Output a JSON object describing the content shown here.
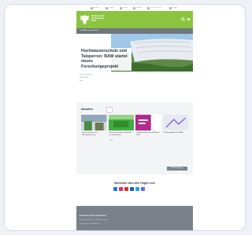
{
  "utility_nav": [
    {
      "label": "Intranet",
      "icon": "lock-icon"
    },
    {
      "label": "Termine",
      "icon": "calendar-icon"
    },
    {
      "label": "Presse",
      "icon": "megaphone-icon"
    },
    {
      "label": "Kontakt",
      "icon": "mail-icon"
    },
    {
      "label": "Leichte Sprache",
      "icon": "language-icon"
    },
    {
      "label": "English",
      "icon": "globe-icon"
    }
  ],
  "header": {
    "logo_line1": "Bundesanstalt",
    "logo_line2": "für Wasserbau",
    "logo_line3": "BAW",
    "brand_color": "#8bc53f"
  },
  "breadcrumb": "Die BAW auf einen Blick",
  "hero": {
    "headline": "Hochwasserschutz und Talsperren: BAW startet neues Forschungsprojekt",
    "meta": "Pressemitteilung",
    "date": "24.03.2024",
    "tag": "Mehr"
  },
  "news": {
    "title": "Aktuelles",
    "items": [
      {
        "text": "Neues Verfahren zur Sohlstabilisierung",
        "thumb_color": "#4c8a3f"
      },
      {
        "text": "Forschung zu Wasserstraßen im Klimawandel",
        "thumb_color": "#3fae3f"
      },
      {
        "text": "Tagung Schleusen und Wehre 2024",
        "thumb_color": "#b12a8e"
      },
      {
        "text": "Stellenangebote der BAW",
        "thumb_color": "#d9d9ec"
      }
    ],
    "more_label": "Alle Meldungen"
  },
  "social": {
    "title": "Weiterhin dies alle Folgen uns",
    "icons": [
      {
        "name": "facebook-icon",
        "color": "#1877f2"
      },
      {
        "name": "instagram-icon",
        "color": "#e1306c"
      },
      {
        "name": "youtube-icon",
        "color": "#e52d27"
      },
      {
        "name": "linkedin-icon",
        "color": "#0a66c2"
      },
      {
        "name": "twitter-icon",
        "color": "#1da1f2"
      },
      {
        "name": "mastodon-icon",
        "color": "#6364ff"
      }
    ]
  },
  "footer": {
    "title": "Bundesanstalt für Wasserbau",
    "line1": "Kußmaulstraße 17 · 76187 Karlsruhe",
    "line2": "Impressum · Datenschutz"
  }
}
